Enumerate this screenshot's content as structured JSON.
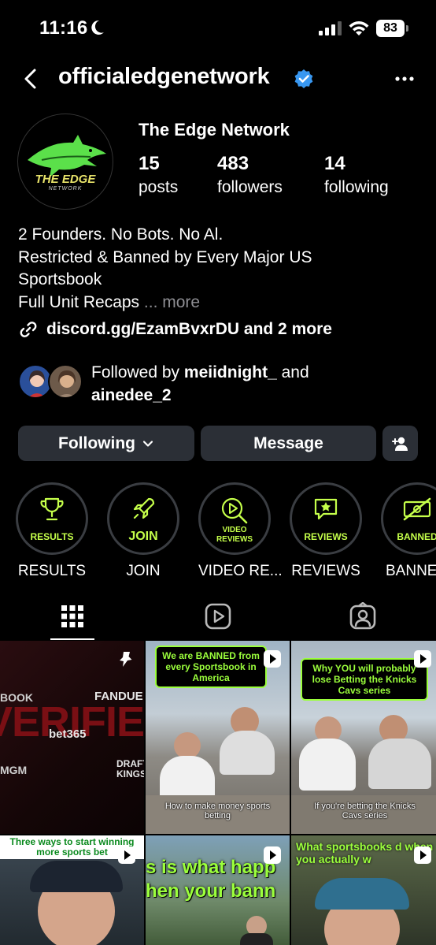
{
  "status_bar": {
    "time": "11:16",
    "battery": "83"
  },
  "nav": {
    "username": "officialedgenetwork"
  },
  "profile": {
    "display_name": "The Edge Network",
    "avatar_text": "THE EDGE",
    "avatar_subtext": "NETWORK",
    "stats": [
      {
        "value": "15",
        "label": "posts"
      },
      {
        "value": "483",
        "label": "followers"
      },
      {
        "value": "14",
        "label": "following"
      }
    ],
    "bio_lines": [
      "2 Founders. No Bots. No Al.",
      "Restricted & Banned by Every Major US",
      "Sportsbook",
      "Full Unit Recaps"
    ],
    "bio_more": "... more",
    "link": "discord.gg/EzamBvxrDU and 2 more"
  },
  "followed_by": {
    "prefix": "Followed by",
    "user1": "meiidnight_",
    "joiner": "and",
    "user2": "ainedee_2"
  },
  "actions": {
    "following_label": "Following",
    "message_label": "Message"
  },
  "highlights": [
    {
      "inner": "RESULTS",
      "label": "RESULTS"
    },
    {
      "inner": "JOIN",
      "label": "JOIN"
    },
    {
      "inner": "VIDEO REVIEWS",
      "label": "VIDEO RE..."
    },
    {
      "inner": "REVIEWS",
      "label": "REVIEWS"
    },
    {
      "inner": "BANNED",
      "label": "BANNE"
    }
  ],
  "posts": {
    "p1": {
      "brands": [
        "BOOK",
        "FANDUEL",
        "bet365",
        "MGM",
        "DRAFT KINGS"
      ],
      "overlay": "VERIFIED"
    },
    "p2": {
      "caption": "We are BANNED from every Sportsbook in America",
      "subtitle": "How to make money sports betting"
    },
    "p3": {
      "caption": "Why YOU will probably lose Betting the Knicks Cavs series",
      "subtitle": "If you're betting the Knicks Cavs series"
    },
    "p4": {
      "caption": "Three ways to start winning more sports bet"
    },
    "p5": {
      "caption": "s is what happ hen your bann"
    },
    "p6": {
      "caption": "What sportsbooks d when you actually w"
    }
  },
  "colors": {
    "background": "#000000",
    "button": "#2b2f36",
    "accent": "#9bff3c",
    "verified": "#3897f0"
  }
}
